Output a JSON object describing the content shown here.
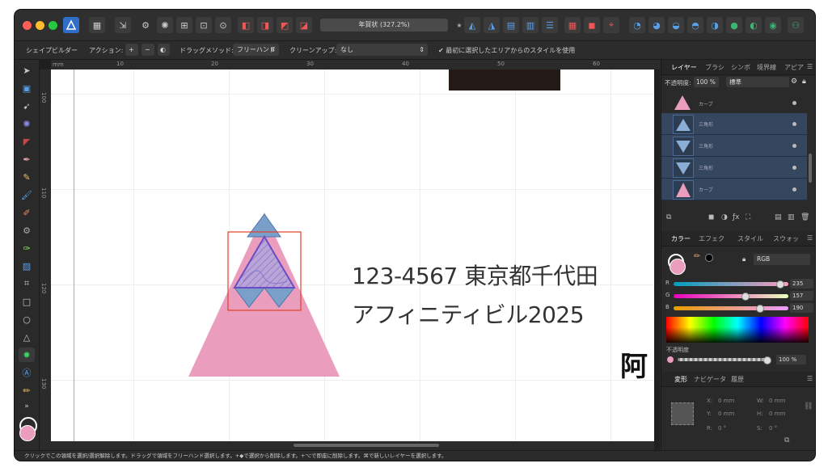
{
  "app": {
    "title": "年賀状 (327.2%)",
    "colors": {
      "accent": "#3a7bd5",
      "layer_selected": "#34475f",
      "shape_pink": "#eb9dbe"
    }
  },
  "context_toolbar": {
    "persona_label": "シェイプビルダー",
    "action_label": "アクション:",
    "action_add": "+",
    "action_subtract": "−",
    "drag_method_label": "ドラッグメソッド:",
    "drag_method_value": "フリーハンド",
    "cleanup_label": "クリーンアップ:",
    "cleanup_value": "なし",
    "checkbox_label": "最初に選択したエリアからのスタイルを使用"
  },
  "rulers": {
    "top": [
      "mm",
      "10",
      "20",
      "30",
      "40",
      "50",
      "60"
    ],
    "left": [
      "100",
      "110",
      "120",
      "130"
    ]
  },
  "canvas": {
    "text_line1": "123-4567 東京都千代田",
    "text_line2": "アフィニティビル2025",
    "text_kanji": "阿"
  },
  "layers_panel": {
    "tabs": [
      "レイヤー",
      "ブラシ",
      "シンボ",
      "境界線",
      "アピア"
    ],
    "opacity_label": "不透明度:",
    "opacity_value": "100 %",
    "blend_mode": "標準",
    "layers": [
      {
        "name": "カーブ",
        "selected": false
      },
      {
        "name": "三角形",
        "selected": true
      },
      {
        "name": "三角形",
        "selected": true
      },
      {
        "name": "三角形",
        "selected": true
      },
      {
        "name": "カーブ",
        "selected": true
      }
    ]
  },
  "color_panel": {
    "tabs": [
      "カラー",
      "エフェク",
      "スタイル",
      "スウォッ"
    ],
    "model": "RGB",
    "r_label": "R",
    "r_value": "235",
    "g_label": "G",
    "g_value": "157",
    "b_label": "B",
    "b_value": "190",
    "opacity_label": "不透明度",
    "opacity_value": "100 %"
  },
  "transform_panel": {
    "tabs": [
      "変形",
      "ナビゲータ",
      "履歴"
    ],
    "x_label": "X:",
    "x_value": "0 mm",
    "y_label": "Y:",
    "y_value": "0 mm",
    "w_label": "W:",
    "w_value": "0 mm",
    "h_label": "H:",
    "h_value": "0 mm",
    "r_label": "R:",
    "r_value": "0 °",
    "s_label": "S:",
    "s_value": "0 °"
  },
  "statusbar": {
    "text": "クリックでこの領域を選択/選択解除します。ドラッグで領域をフリーハンド選択します。+◆で選択から削除します。+⌥で即座に削除します。⌘で新しいレイヤーを選択します。"
  }
}
